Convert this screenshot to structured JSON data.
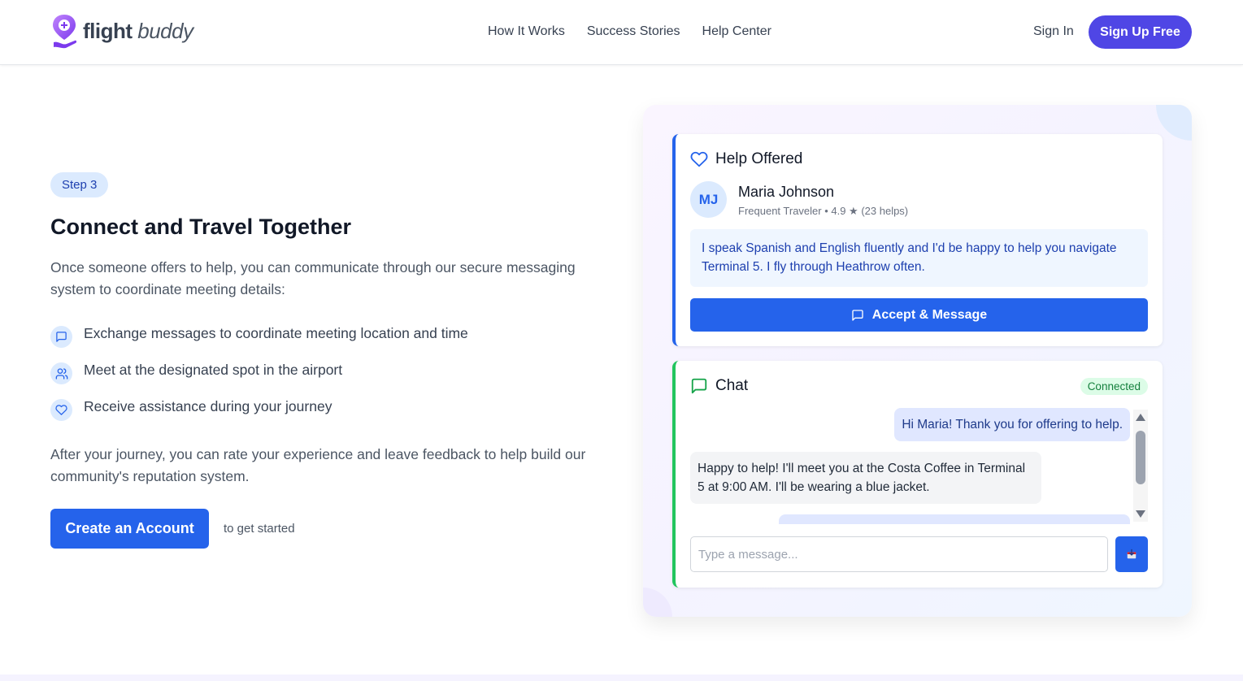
{
  "brand": {
    "name_part1": "flight",
    "name_part2": "buddy"
  },
  "nav": {
    "items": [
      "How It Works",
      "Success Stories",
      "Help Center"
    ],
    "sign_in": "Sign In",
    "sign_up": "Sign Up Free"
  },
  "step": {
    "badge": "Step 3",
    "title": "Connect and Travel Together",
    "intro": "Once someone offers to help, you can communicate through our secure messaging system to coordinate meeting details:",
    "features": [
      {
        "icon": "message-square-icon",
        "text": "Exchange messages to coordinate meeting location and time"
      },
      {
        "icon": "users-icon",
        "text": "Meet at the designated spot in the airport"
      },
      {
        "icon": "heart-icon",
        "text": "Receive assistance during your journey"
      }
    ],
    "outro": "After your journey, you can rate your experience and leave feedback to help build our community's reputation system.",
    "cta_button": "Create an Account",
    "cta_suffix": "to get started"
  },
  "help_card": {
    "title": "Help Offered",
    "avatar_initials": "MJ",
    "helper_name": "Maria Johnson",
    "helper_meta": "Frequent Traveler • 4.9 ★ (23 helps)",
    "message": "I speak Spanish and English fluently and I'd be happy to help you navigate Terminal 5. I fly through Heathrow often.",
    "accept_button": "Accept & Message"
  },
  "chat_card": {
    "title": "Chat",
    "status": "Connected",
    "messages": [
      {
        "from": "me",
        "text": "Hi Maria! Thank you for offering to help."
      },
      {
        "from": "helper",
        "text": "Happy to help! I'll meet you at the Costa Coffee in Terminal 5 at 9:00 AM. I'll be wearing a blue jacket."
      }
    ],
    "input_placeholder": "Type a message..."
  },
  "colors": {
    "primary": "#2563eb",
    "brand_purple": "#4f46e5",
    "success": "#22c55e"
  }
}
